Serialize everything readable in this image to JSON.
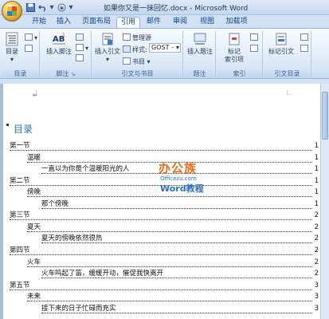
{
  "window": {
    "title": "如果你又是一抹回忆.docx - Microsoft Word"
  },
  "tabs": [
    "开始",
    "插入",
    "页面布局",
    "引用",
    "邮件",
    "审阅",
    "视图",
    "加载项"
  ],
  "active_tab": "引用",
  "ribbon": {
    "toc_group": {
      "label": "目录",
      "toc_button": "目录"
    },
    "footnote_group": {
      "label": "脚注",
      "insert_footnote": "插入脚注"
    },
    "citation_group": {
      "label": "引文与书目",
      "insert_citation": "插入引文",
      "manage_sources": "管理源",
      "style_label": "样式:",
      "style_value": "GOST - ",
      "bibliography": "书目"
    },
    "caption_group": {
      "label": "题注",
      "insert_caption": "插入题注"
    },
    "index_group": {
      "label": "索引",
      "mark_entry_line1": "标记",
      "mark_entry_line2": "索引项"
    },
    "toa_group": {
      "label": "引文目录",
      "mark_citation": "标记引文"
    }
  },
  "watermark": {
    "brand_cn": "办公族",
    "url": "Officezu.com",
    "word_label": "Word教程"
  },
  "document": {
    "toc_title": "目录",
    "entries": [
      {
        "text": "第一节",
        "page": "1",
        "level": 1
      },
      {
        "text": "温暖",
        "page": "1",
        "level": 2
      },
      {
        "text": "一直以为你是个温暖阳光的人",
        "page": "1",
        "level": 3
      },
      {
        "text": "第二节",
        "page": "1",
        "level": 1
      },
      {
        "text": "傍晚",
        "page": "1",
        "level": 2
      },
      {
        "text": "那个傍晚",
        "page": "1",
        "level": 3
      },
      {
        "text": "第三节",
        "page": "2",
        "level": 1
      },
      {
        "text": "夏天",
        "page": "2",
        "level": 2
      },
      {
        "text": "夏天的傍晚依然很热",
        "page": "2",
        "level": 3
      },
      {
        "text": "第四节",
        "page": "2",
        "level": 1
      },
      {
        "text": "火车",
        "page": "2",
        "level": 2
      },
      {
        "text": "火车鸣起了笛，缓缓开动，催促我快离开",
        "page": "2",
        "level": 3
      },
      {
        "text": "第五节",
        "page": "3",
        "level": 1
      },
      {
        "text": "未来",
        "page": "3",
        "level": 2
      },
      {
        "text": "接下来的日子忙碌而充实",
        "page": "3",
        "level": 3
      }
    ]
  }
}
